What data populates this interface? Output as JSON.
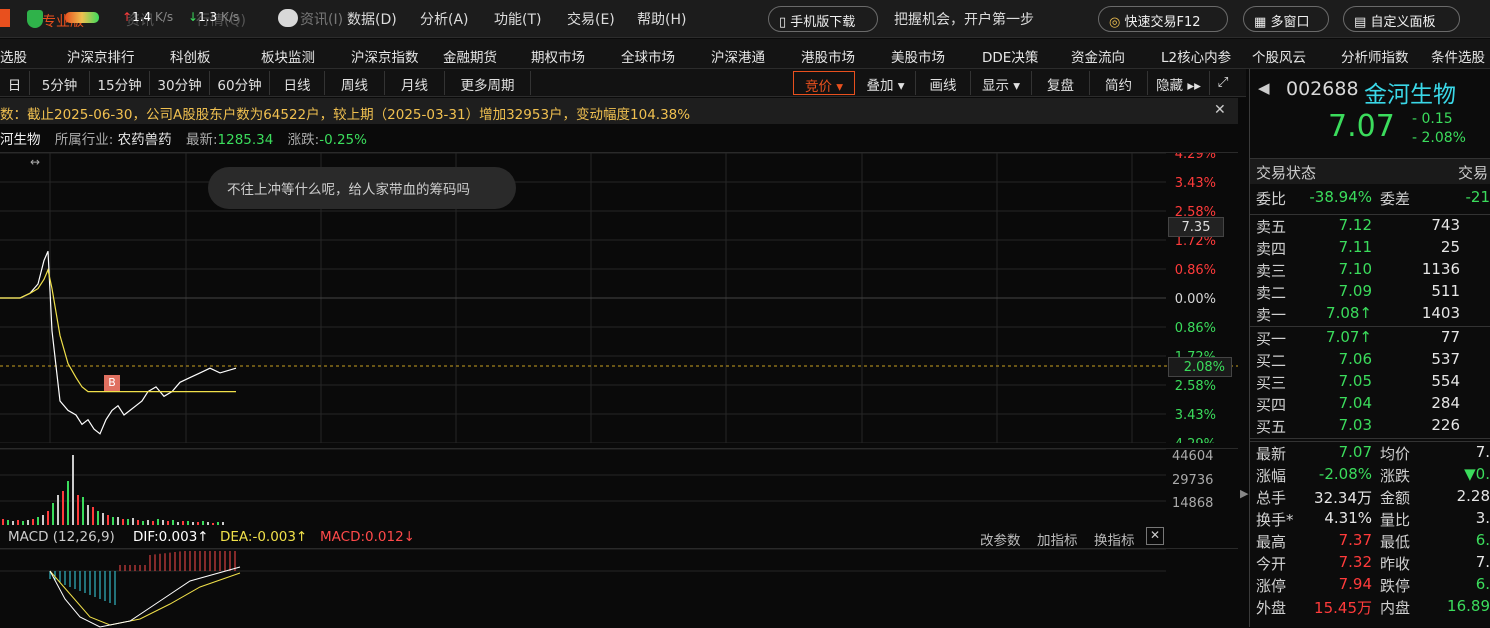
{
  "menubar": {
    "brand": "专业版",
    "speed_up": "1.4",
    "speed_down": "1.3",
    "speed_unit1": "K/s",
    "speed_unit2": "K/s",
    "menu": [
      "资讯(I)",
      "数据(D)",
      "分析(A)",
      "功能(T)",
      "交易(E)",
      "帮助(H)"
    ],
    "mobile_btn": "手机版下载",
    "slogan": "把握机会，开户第一步",
    "quick_trade": "快速交易F12",
    "multi_window": "多窗口",
    "custom_panel": "自定义面板",
    "bg_a": "资讯",
    "bg_b": "行情(Q)"
  },
  "nav": [
    "选股",
    "沪深京排行",
    "科创板",
    "板块监测",
    "沪深京指数",
    "金融期货",
    "期权市场",
    "全球市场",
    "沪深港通",
    "港股市场",
    "美股市场",
    "DDE决策",
    "资金流向",
    "L2核心内参",
    "个股风云",
    "分析师指数",
    "条件选股"
  ],
  "periods": [
    "日",
    "5分钟",
    "15分钟",
    "30分钟",
    "60分钟",
    "日线",
    "周线",
    "月线",
    "更多周期"
  ],
  "tools": [
    "竞价",
    "叠加",
    "画线",
    "显示",
    "复盘",
    "简约",
    "隐藏"
  ],
  "info_text": "数：截止2025-06-30，公司A股股东户数为64522户，较上期（2025-03-31）增加32953户，变动幅度104.38%",
  "stock_line": {
    "name": "河生物",
    "industry_label": "所属行业:",
    "industry": "农药兽药",
    "latest_label": "最新:",
    "latest": "1285.34",
    "change_label": "涨跌:",
    "change": "-0.25%"
  },
  "comment": "不往上冲等什么呢，给人家带血的筹码吗",
  "price_labels": [
    "4.29%",
    "3.43%",
    "2.58%",
    "1.72%",
    "0.86%",
    "0.00%",
    "0.86%",
    "1.72%",
    "2.58%",
    "3.43%",
    "4.29%"
  ],
  "price_tag": "7.35",
  "pct_tag": "2.08%",
  "b_marker": "B",
  "vol_labels": [
    "44604",
    "29736",
    "14868"
  ],
  "macd": {
    "name": "MACD (12,26,9)",
    "dif": "DIF:0.003↑",
    "dea": "DEA:-0.003↑",
    "macd": "MACD:0.012↓",
    "btn1": "改参数",
    "btn2": "加指标",
    "btn3": "换指标"
  },
  "chart_data": {
    "type": "line",
    "title": "",
    "xlabel": "",
    "ylabel": "",
    "series": [
      {
        "name": "",
        "values": [
          7.22,
          7.22,
          7.22,
          7.23,
          7.25,
          7.3,
          7.32,
          7.15,
          7.0,
          6.98,
          6.97,
          6.95,
          6.96,
          6.94,
          6.93,
          6.96,
          6.98,
          6.99,
          6.97,
          6.98,
          6.99,
          7.0,
          7.02,
          7.03,
          7.01,
          7.02,
          7.04,
          7.05,
          7.06,
          7.07,
          7.06,
          7.07
        ]
      }
    ],
    "prev_close": 7.22
  },
  "right": {
    "code": "002688",
    "name": "金河生物",
    "price": "7.07",
    "chg": "- 0.15",
    "chg_pct": "- 2.08%",
    "status_label": "交易状态",
    "status_val": "交易",
    "wb_label": "委比",
    "wb": "-38.94%",
    "wc_label": "委差",
    "wc": "-21",
    "asks": [
      {
        "l": "卖五",
        "p": "7.12",
        "v": "743"
      },
      {
        "l": "卖四",
        "p": "7.11",
        "v": "25"
      },
      {
        "l": "卖三",
        "p": "7.10",
        "v": "1136"
      },
      {
        "l": "卖二",
        "p": "7.09",
        "v": "511"
      },
      {
        "l": "卖一",
        "p": "7.08↑",
        "v": "1403"
      }
    ],
    "bids": [
      {
        "l": "买一",
        "p": "7.07↑",
        "v": "77"
      },
      {
        "l": "买二",
        "p": "7.06",
        "v": "537"
      },
      {
        "l": "买三",
        "p": "7.05",
        "v": "554"
      },
      {
        "l": "买四",
        "p": "7.04",
        "v": "284"
      },
      {
        "l": "买五",
        "p": "7.03",
        "v": "226"
      }
    ],
    "stats": [
      {
        "l1": "最新",
        "v1": "7.07",
        "l2": "均价",
        "v2": "7."
      },
      {
        "l1": "涨幅",
        "v1": "-2.08%",
        "l2": "涨跌",
        "v2": "▼0."
      },
      {
        "l1": "总手",
        "v1": "32.34万",
        "l2": "金额",
        "v2": "2.28"
      },
      {
        "l1": "换手*",
        "v1": "4.31%",
        "l2": "量比",
        "v2": "3."
      },
      {
        "l1": "最高",
        "v1": "7.37",
        "l2": "最低",
        "v2": "6."
      },
      {
        "l1": "今开",
        "v1": "7.32",
        "l2": "昨收",
        "v2": "7."
      },
      {
        "l1": "涨停",
        "v1": "7.94",
        "l2": "跌停",
        "v2": "6."
      },
      {
        "l1": "外盘",
        "v1": "15.45万",
        "l2": "内盘",
        "v2": "16.89"
      }
    ]
  }
}
